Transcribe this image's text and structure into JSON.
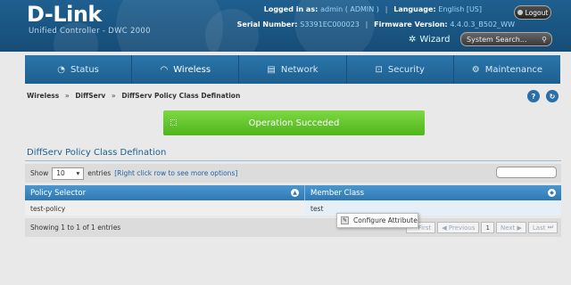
{
  "header": {
    "logo": "D-Link",
    "subtitle": "Unified Controller - DWC 2000",
    "logged_in_label": "Logged in as:",
    "logged_in_user": "admin ( ADMIN )",
    "language_label": "Language:",
    "language_value": "English [US]",
    "serial_label": "Serial Number:",
    "serial_value": "S3391EC000023",
    "firmware_label": "Firmware Version:",
    "firmware_value": "4.4.0.3_B502_WW",
    "logout_label": "Logout",
    "wizard_label": "Wizard",
    "search_placeholder": "System Search..."
  },
  "nav": {
    "tabs": [
      {
        "label": "Status",
        "icon": "gauge-icon"
      },
      {
        "label": "Wireless",
        "icon": "wifi-icon"
      },
      {
        "label": "Network",
        "icon": "network-icon"
      },
      {
        "label": "Security",
        "icon": "lock-icon"
      },
      {
        "label": "Maintenance",
        "icon": "gears-icon"
      }
    ],
    "active": "Wireless"
  },
  "breadcrumb": {
    "items": [
      "Wireless",
      "DiffServ",
      "DiffServ Policy Class Defination"
    ],
    "separator": "»"
  },
  "alert": {
    "message": "Operation Succeded"
  },
  "section": {
    "title": "DiffServ Policy Class Defination"
  },
  "toolbar": {
    "show_label": "Show",
    "entries_value": "10",
    "entries_label": "entries",
    "hint": "[Right click row to see more options]"
  },
  "table": {
    "columns": [
      "Policy Selector",
      "Member Class"
    ],
    "rows": [
      [
        "test-policy",
        "test"
      ]
    ]
  },
  "context_menu": {
    "item": "Configure Attribute"
  },
  "footer": {
    "summary": "Showing 1 to 1 of 1 entries",
    "pager": [
      "First",
      "Previous",
      "1",
      "Next",
      "Last"
    ]
  },
  "colors": {
    "accent": "#2b76ab",
    "success": "#5cc22a",
    "header": "#1f5f8f"
  }
}
